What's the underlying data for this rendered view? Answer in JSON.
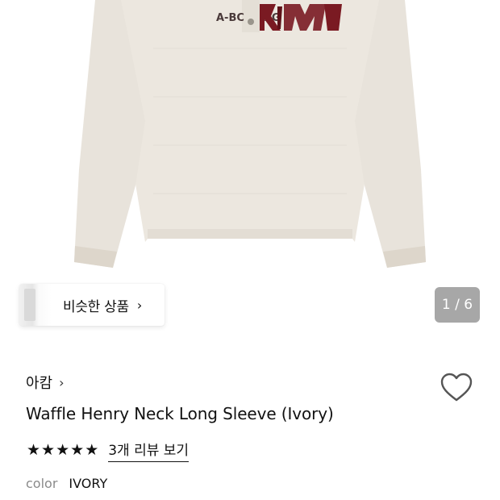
{
  "product_image": {
    "print_text": "A-BC BCKM"
  },
  "similar_products": {
    "label": "비슷한 상품",
    "chevron": "›"
  },
  "gallery": {
    "counter": "1 / 6"
  },
  "brand": {
    "name": "아캄",
    "chevron": "›"
  },
  "wishlist": {
    "icon": "heart-outline-icon"
  },
  "product": {
    "title": "Waffle Henry Neck Long Sleeve (Ivory)",
    "rating": 5,
    "stars": [
      "★",
      "★",
      "★",
      "★",
      "★"
    ],
    "review_link": "3개 리뷰 보기",
    "color_label": "color",
    "color_value": "IVORY"
  },
  "colors": {
    "garment": "#ece7df",
    "garment_shadow": "#ddd6cb",
    "print": "#7a1a22",
    "counter_bg": "#a7a7a7"
  }
}
